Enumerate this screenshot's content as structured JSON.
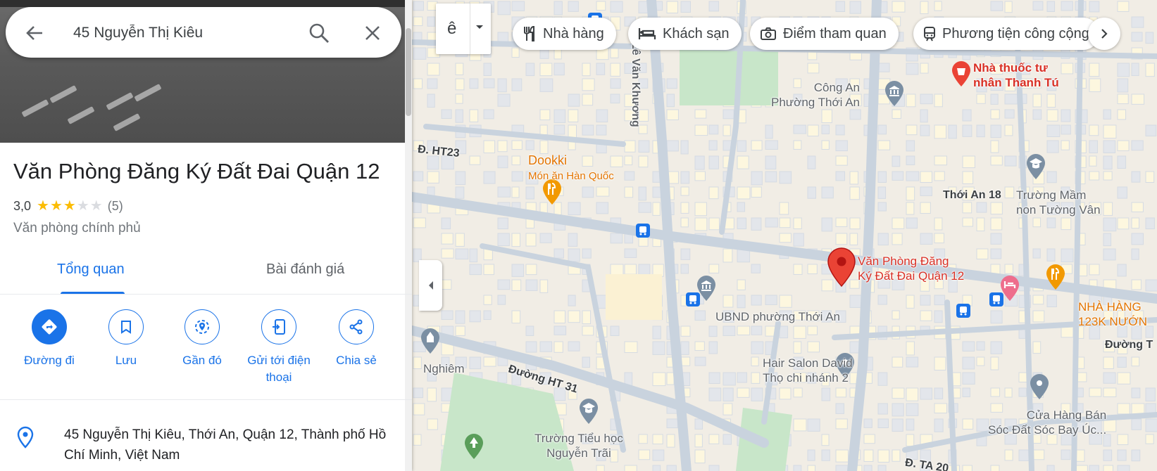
{
  "search": {
    "query": "45 Nguyễn Thị Kiêu"
  },
  "place": {
    "title": "Văn Phòng Đăng Ký Đất Đai Quận 12",
    "rating": "3,0",
    "rating_value": 3,
    "rating_max": 5,
    "review_count": "(5)",
    "category": "Văn phòng chính phủ",
    "address": "45 Nguyễn Thị Kiêu, Thới An, Quận 12, Thành phố Hồ Chí Minh, Việt Nam"
  },
  "tabs": [
    {
      "label": "Tổng quan",
      "active": true
    },
    {
      "label": "Bài đánh giá",
      "active": false
    }
  ],
  "actions": [
    {
      "label": "Đường đi",
      "icon": "directions-icon"
    },
    {
      "label": "Lưu",
      "icon": "bookmark-icon"
    },
    {
      "label": "Gần đó",
      "icon": "nearby-icon"
    },
    {
      "label": "Gửi tới điện thoại",
      "icon": "send-to-phone-icon"
    },
    {
      "label": "Chia sẻ",
      "icon": "share-icon"
    }
  ],
  "map": {
    "layer_glyph": "ê",
    "chips": [
      {
        "label": "Nhà hàng",
        "icon": "restaurant-icon"
      },
      {
        "label": "Khách sạn",
        "icon": "hotel-icon"
      },
      {
        "label": "Điểm tham quan",
        "icon": "camera-icon"
      },
      {
        "label": "Phương tiện công cộng",
        "icon": "transit-icon"
      }
    ],
    "labels": {
      "pharmacy_1": "Nhà thuốc tư",
      "pharmacy_2": "nhân Thanh Tú",
      "police_1": "Công An",
      "police_2": "Phường Thới An",
      "road_ht23": "Đ. HT23",
      "dookki": "Dookki",
      "dookki_sub": "Món ăn Hàn Quốc",
      "thoi_an_18": "Thới An 18",
      "school_1": "Trường Mầm",
      "school_2": "non Tường Vân",
      "selected_1": "Văn Phòng Đăng",
      "selected_2": "Ký Đất Đai Quận 12",
      "ubnd": "UBND phường Thới An",
      "nhahang_1": "NHÀ HÀNG",
      "nhahang_2": "123K NƯỚN",
      "duong_t": "Đường T",
      "nghiem": "Nghiêm",
      "ht31": "Đường HT 31",
      "hair_1": "Hair Salon David",
      "hair_2": "Thọ chi nhánh 2",
      "tieuhoc_1": "Trường Tiểu học",
      "tieuhoc_2": "Nguyễn Trãi",
      "cuahang_1": "Cửa Hàng Bán",
      "cuahang_2": "Sóc Đất Sóc Bay Úc...",
      "dta20": "Đ. TA 20",
      "vertical_road": "Lê Văn Khương"
    }
  },
  "colors": {
    "accent": "#1a73e8",
    "pin": "#ea4335",
    "star": "#fbbc04",
    "poi_orange": "#f29900",
    "map_land": "#f1ede5",
    "map_road": "#c9d3de",
    "map_park": "#c8e6c9"
  }
}
